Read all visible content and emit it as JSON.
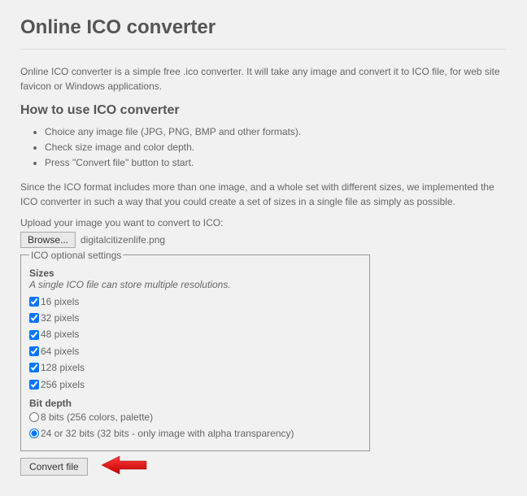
{
  "title": "Online ICO converter",
  "intro": "Online ICO converter is a simple free .ico converter. It will take any image and convert it to ICO file, for web site favicon or Windows applications.",
  "howto_heading": "How to use ICO converter",
  "steps": [
    "Choice any image file (JPG, PNG, BMP and other formats).",
    "Check size image and color depth.",
    "Press \"Convert file\" button to start."
  ],
  "description": "Since the ICO format includes more than one image, and a whole set with different sizes, we implemented the ICO converter in such a way that you could create a set of sizes in a single file as simply as possible.",
  "upload_label": "Upload your image you want to convert to ICO:",
  "browse_label": "Browse...",
  "filename": "digitalcitizenlife.png",
  "fieldset_legend": "ICO optional settings",
  "sizes_title": "Sizes",
  "sizes_note": "A single ICO file can store multiple resolutions.",
  "sizes": [
    {
      "label": "16 pixels"
    },
    {
      "label": "32 pixels"
    },
    {
      "label": "48 pixels"
    },
    {
      "label": "64 pixels"
    },
    {
      "label": "128 pixels"
    },
    {
      "label": "256 pixels"
    }
  ],
  "bitdepth_title": "Bit depth",
  "bitdepth": [
    {
      "label": "8 bits (256 colors, palette)"
    },
    {
      "label": "24 or 32 bits (32 bits - only image with alpha transparency)"
    }
  ],
  "convert_label": "Convert file"
}
